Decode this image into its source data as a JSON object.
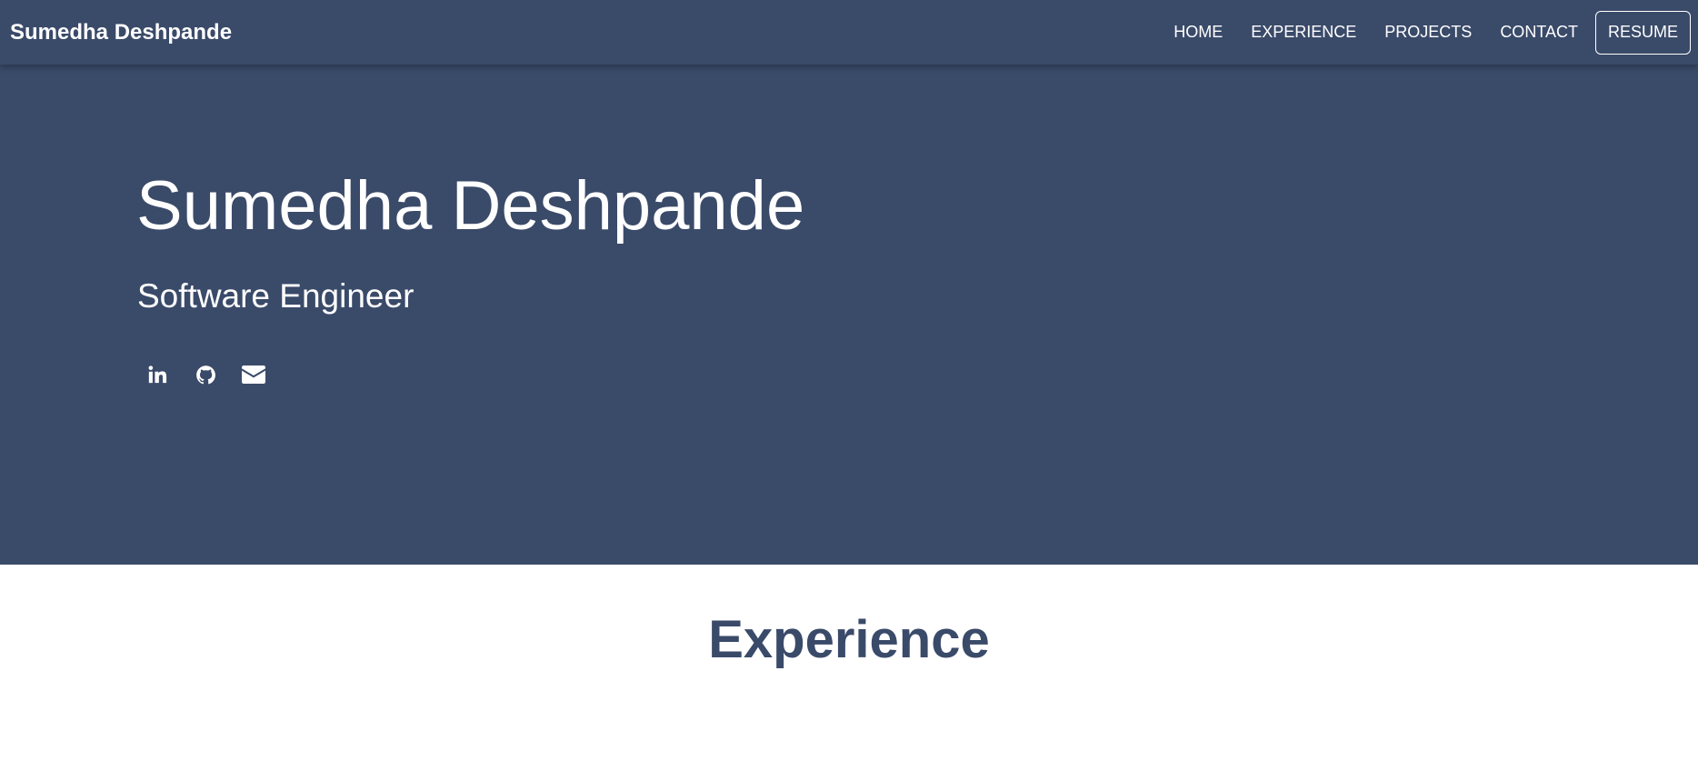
{
  "navbar": {
    "brand": "Sumedha Deshpande",
    "links": [
      "HOME",
      "EXPERIENCE",
      "PROJECTS",
      "CONTACT"
    ],
    "resume_label": "RESUME"
  },
  "hero": {
    "name": "Sumedha Deshpande",
    "title": "Software Engineer",
    "socials": [
      "linkedin-icon",
      "github-icon",
      "email-icon"
    ]
  },
  "experience": {
    "heading": "Experience"
  },
  "colors": {
    "primary": "#3a4a69",
    "text_light": "#ffffff",
    "background": "#ffffff"
  }
}
